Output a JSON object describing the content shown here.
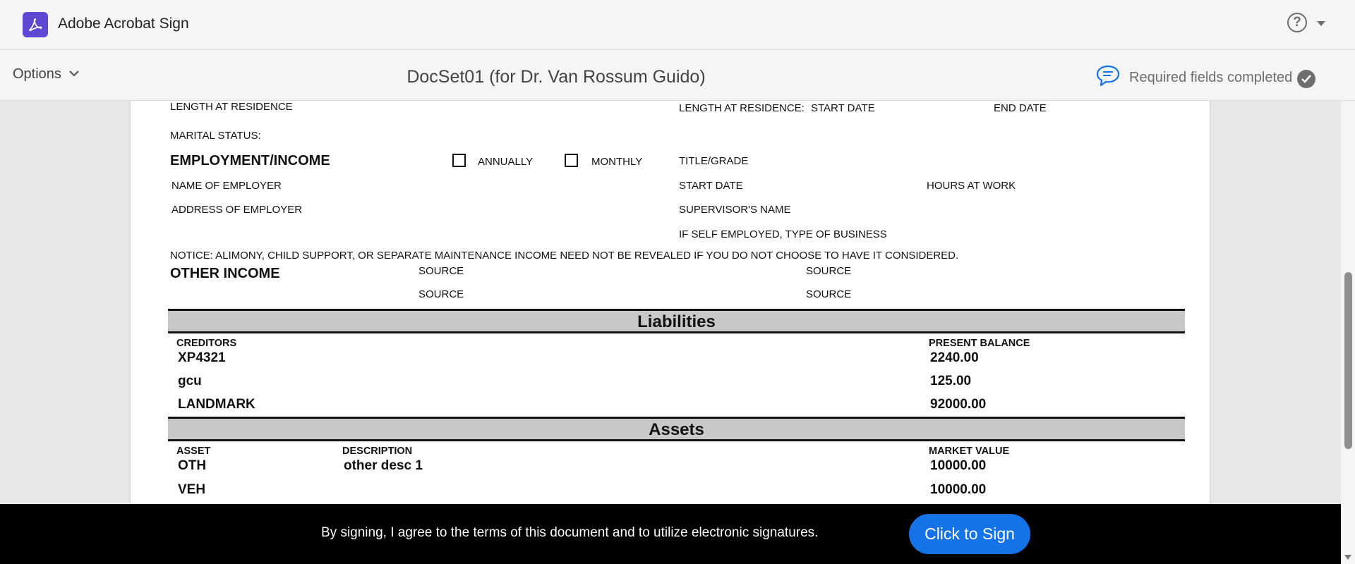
{
  "app": {
    "name": "Adobe Acrobat Sign",
    "help_symbol": "?"
  },
  "toolbar": {
    "options_label": "Options",
    "document_title": "DocSet01 (for Dr. Van Rossum Guido)",
    "status_text": "Required fields completed"
  },
  "form": {
    "length_at_residence": "LENGTH AT RESIDENCE",
    "length_at_residence_right": "LENGTH AT RESIDENCE:",
    "start_date": "START DATE",
    "end_date": "END DATE",
    "marital_status": "MARITAL STATUS:",
    "employment_income": "EMPLOYMENT/INCOME",
    "annually": "ANNUALLY",
    "monthly": "MONTHLY",
    "title_grade": "TITLE/GRADE",
    "name_of_employer": "NAME OF EMPLOYER",
    "start_date_2": "START DATE",
    "hours_at_work": "HOURS AT WORK",
    "address_of_employer": "ADDRESS OF EMPLOYER",
    "supervisors_name": "SUPERVISOR'S NAME",
    "self_employed": "IF SELF EMPLOYED, TYPE OF BUSINESS",
    "notice": "NOTICE: ALIMONY, CHILD SUPPORT, OR SEPARATE MAINTENANCE INCOME NEED NOT BE REVEALED IF YOU DO NOT CHOOSE TO HAVE IT CONSIDERED.",
    "other_income": "OTHER INCOME",
    "source_label": "SOURCE"
  },
  "liabilities": {
    "heading": "Liabilities",
    "col_creditors": "CREDITORS",
    "col_balance": "PRESENT BALANCE",
    "rows": [
      {
        "creditor": "XP4321",
        "balance": "2240.00"
      },
      {
        "creditor": "gcu",
        "balance": "125.00"
      },
      {
        "creditor": "LANDMARK",
        "balance": "92000.00"
      }
    ]
  },
  "assets": {
    "heading": "Assets",
    "col_asset": "ASSET",
    "col_description": "DESCRIPTION",
    "col_market_value": "MARKET VALUE",
    "rows": [
      {
        "asset": "OTH",
        "description": "other desc 1",
        "value": "10000.00"
      },
      {
        "asset": "VEH",
        "description": "",
        "value": "10000.00"
      }
    ]
  },
  "signbar": {
    "agreement_text": "By signing, I agree to the terms of this document and to utilize electronic signatures.",
    "sign_button": "Click to Sign"
  },
  "colors": {
    "brand": "#5c48d3",
    "primary_button": "#1473e6",
    "comment_icon": "#1473e6",
    "band_gray": "#c8c8c8"
  },
  "icons": [
    "acrobat-logo-icon",
    "help-icon",
    "chevron-down-icon",
    "comment-icon",
    "checkmark-icon"
  ]
}
